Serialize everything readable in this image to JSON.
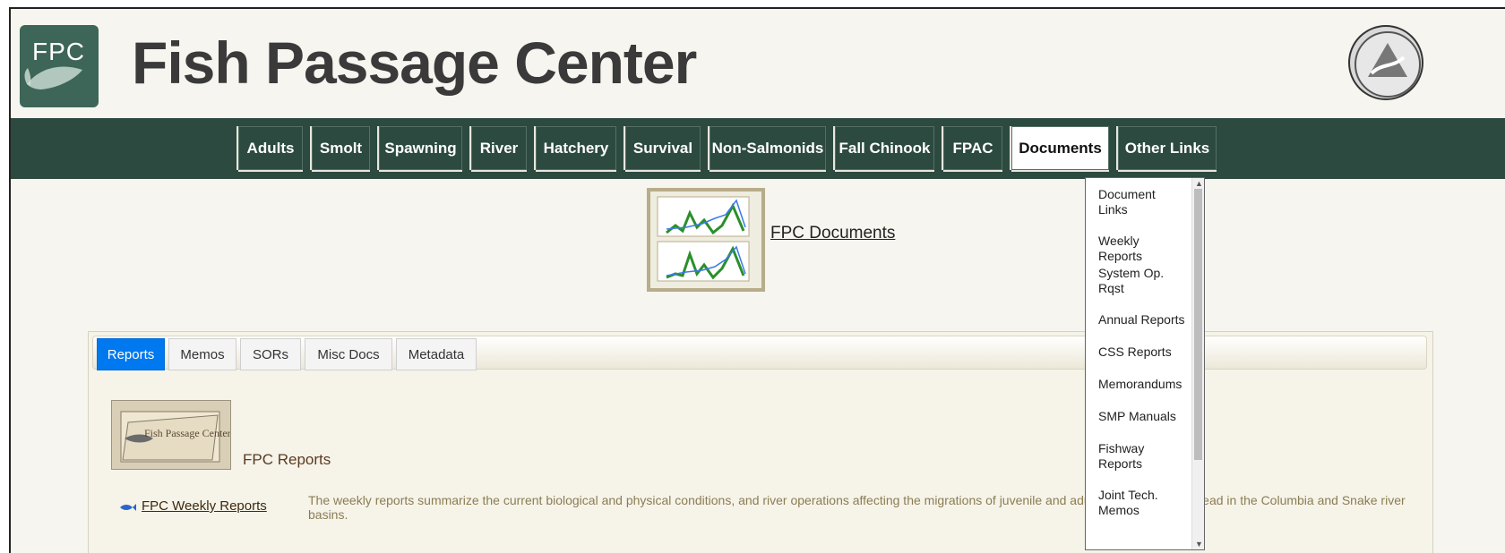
{
  "site": {
    "logo_text": "FPC",
    "title": "Fish Passage Center"
  },
  "nav": {
    "items": [
      {
        "label": "Adults"
      },
      {
        "label": "Smolt"
      },
      {
        "label": "Spawning"
      },
      {
        "label": "River"
      },
      {
        "label": "Hatchery"
      },
      {
        "label": "Survival"
      },
      {
        "label": "Non-Salmonids"
      },
      {
        "label": "Fall Chinook"
      },
      {
        "label": "FPAC"
      },
      {
        "label": "Documents",
        "active": true
      },
      {
        "label": "Other Links"
      }
    ]
  },
  "documents_dropdown": {
    "items": [
      {
        "label": "Document Links"
      },
      {
        "label": "Weekly Reports"
      },
      {
        "label": "System Op. Rqst"
      },
      {
        "label": "Annual Reports"
      },
      {
        "label": "CSS Reports"
      },
      {
        "label": "Memorandums"
      },
      {
        "label": "SMP Manuals"
      },
      {
        "label": "Fishway Reports"
      },
      {
        "label": "Joint Tech. Memos"
      }
    ]
  },
  "page": {
    "heading_link": "FPC Documents"
  },
  "tabs": {
    "items": [
      {
        "label": "Reports",
        "active": true
      },
      {
        "label": "Memos"
      },
      {
        "label": "SORs"
      },
      {
        "label": "Misc Docs"
      },
      {
        "label": "Metadata"
      }
    ]
  },
  "reports": {
    "image_caption": "Fish Passage Center",
    "title": "FPC Reports",
    "rows": [
      {
        "link": "FPC Weekly Reports",
        "description": "The weekly reports summarize the current biological and physical conditions, and river operations affecting the migrations of juvenile and adult salmon and steelhead in the Columbia and Snake river basins."
      }
    ]
  },
  "colors": {
    "nav_bg": "#2d4a40",
    "tab_active": "#0078ef",
    "page_bg": "#f6f5ef"
  }
}
